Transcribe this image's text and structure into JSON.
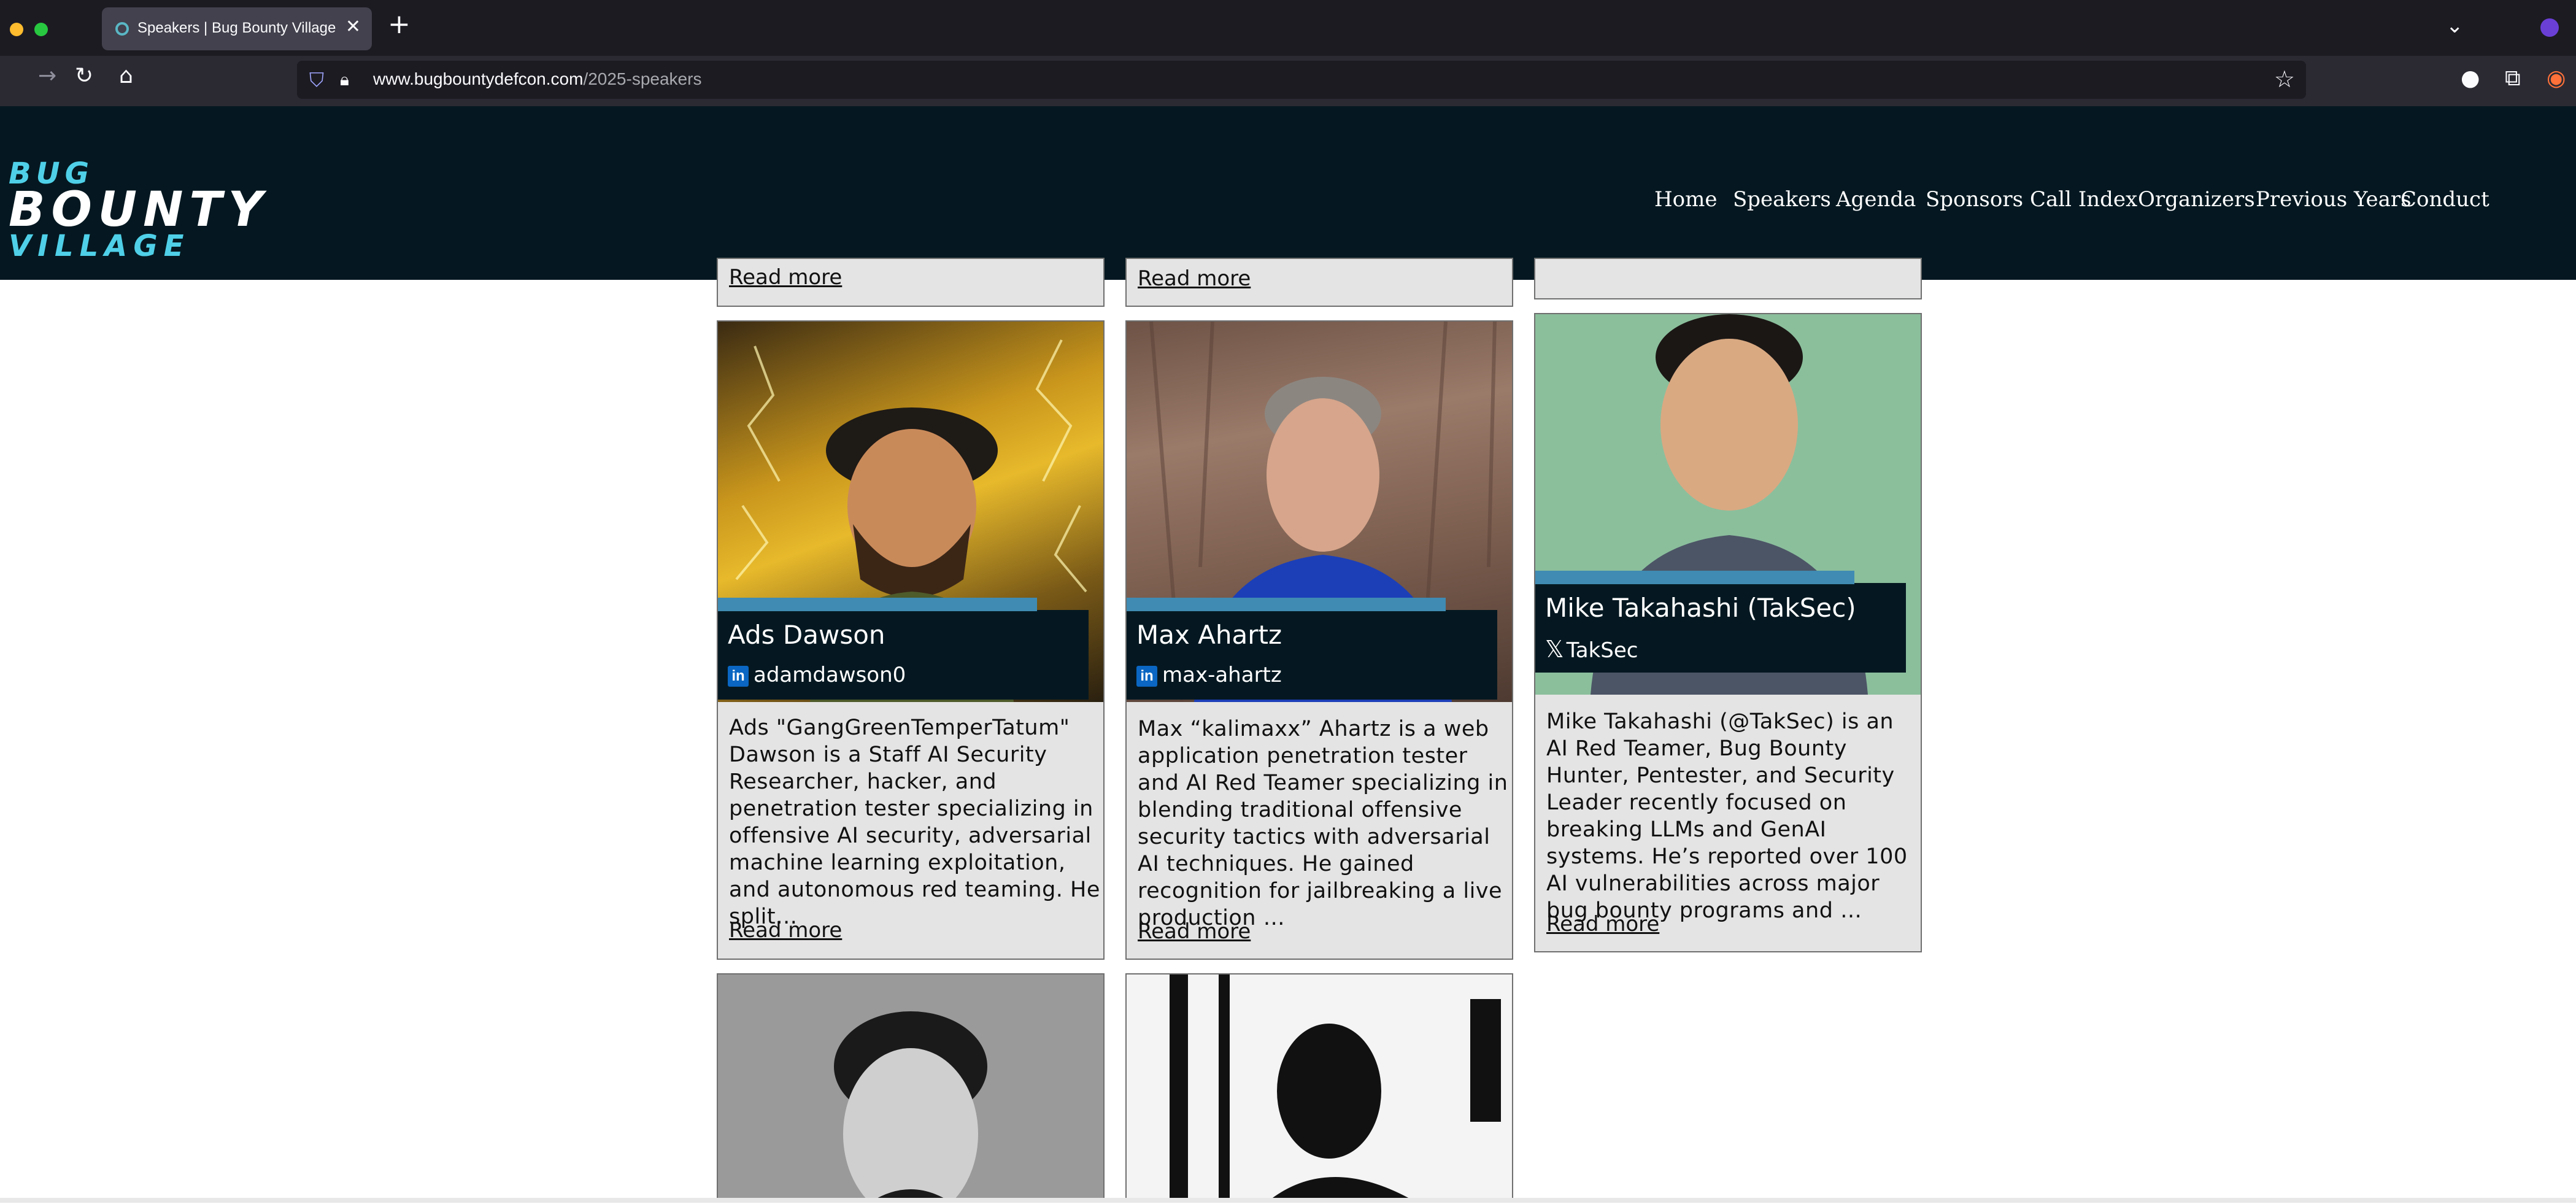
{
  "browser": {
    "tab_title": "Speakers | Bug Bounty Village",
    "url_host": "www.bugbountydefcon.com",
    "url_path": "/2025-speakers",
    "traffic_colors": [
      "#febc2e",
      "#28c840"
    ]
  },
  "site": {
    "logo": [
      "BUG",
      "BOUNTY",
      "VILLAGE"
    ],
    "nav": [
      "Home",
      "Speakers",
      "Agenda",
      "Sponsors",
      "Call Index",
      "Organizers",
      "Previous Years",
      "Conduct"
    ],
    "accent_color": "#3f8bb3",
    "header_bg": "#051821"
  },
  "prev_row": {
    "read_more": "Read more"
  },
  "speakers": [
    {
      "name": "Ads Dawson",
      "social_icon": "linkedin-icon",
      "handle": "adamdawson0",
      "bio": "Ads \"GangGreenTemperTatum\" Dawson is a Staff AI Security Researcher, hacker, and penetration tester specializing in offensive AI security, adversarial machine learning exploitation, and autonomous red teaming. He split…",
      "read_more": "Read more"
    },
    {
      "name": "Max Ahartz",
      "social_icon": "linkedin-icon",
      "handle": "max-ahartz",
      "bio": "Max “kalimaxx” Ahartz is a web application penetration tester and AI Red Teamer specializing in blending traditional offensive security tactics with adversarial AI techniques. He gained recognition for jailbreaking a live production …",
      "read_more": "Read more"
    },
    {
      "name": "Mike Takahashi (TakSec)",
      "social_icon": "x-icon",
      "handle": "TakSec",
      "bio": "Mike Takahashi (@TakSec) is an AI Red Teamer, Bug Bounty Hunter, Pentester, and Security Leader recently focused on breaking LLMs and GenAI systems. He’s reported over 100 AI vulnerabilities across major bug bounty programs and …",
      "read_more": "Read more"
    }
  ]
}
